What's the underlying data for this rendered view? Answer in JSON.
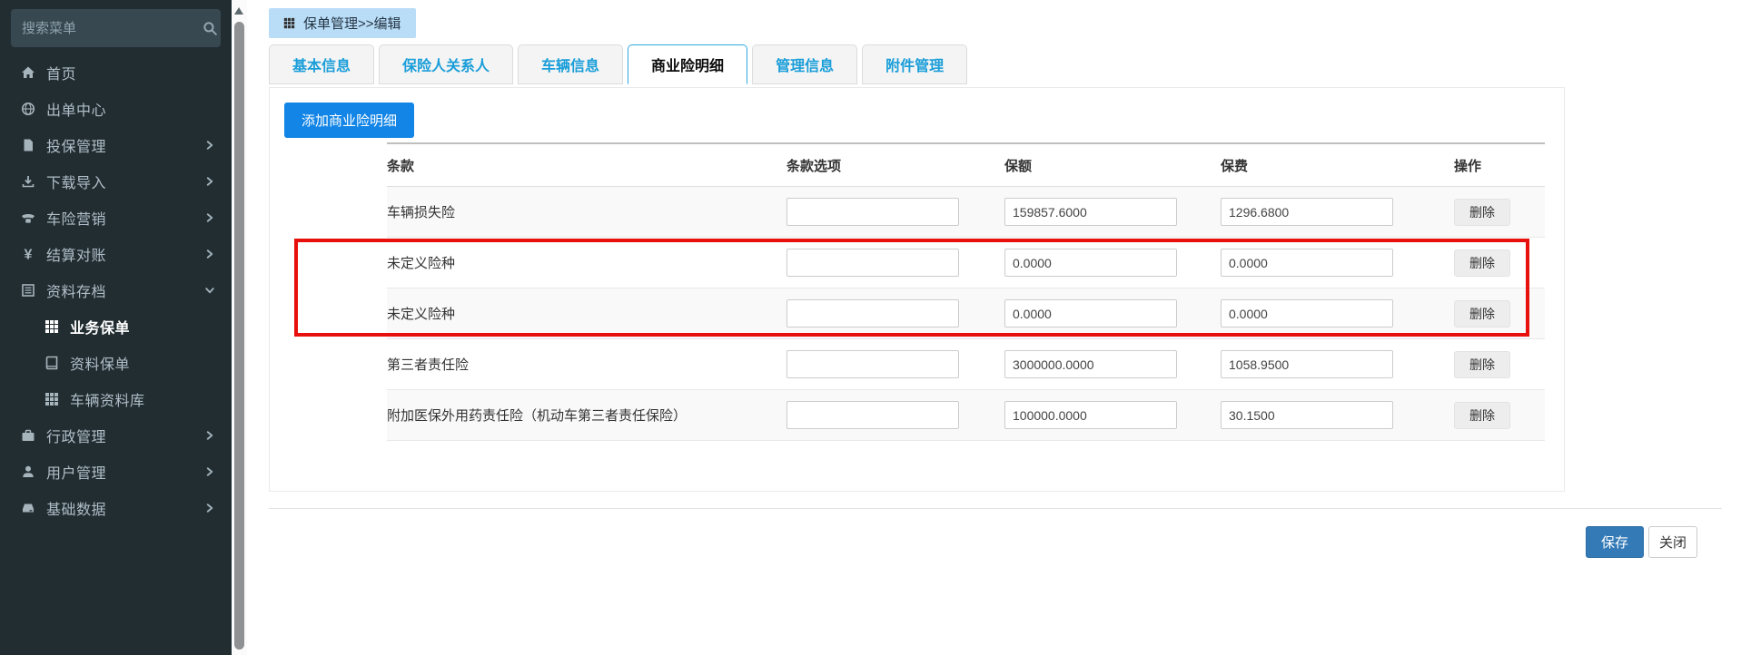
{
  "sidebar": {
    "search_placeholder": "搜索菜单",
    "items": [
      {
        "key": "home",
        "icon": "home",
        "label": "首页"
      },
      {
        "key": "issue-center",
        "icon": "globe",
        "label": "出单中心"
      },
      {
        "key": "insure-management",
        "icon": "file",
        "label": "投保管理",
        "chevron": "right"
      },
      {
        "key": "download-import",
        "icon": "download",
        "label": "下载导入",
        "chevron": "right"
      },
      {
        "key": "vehicle-marketing",
        "icon": "phone",
        "label": "车险营销",
        "chevron": "right"
      },
      {
        "key": "settlement",
        "icon": "yen",
        "label": "结算对账",
        "chevron": "right"
      },
      {
        "key": "archive",
        "icon": "archive",
        "label": "资料存档",
        "chevron": "down"
      },
      {
        "key": "business-policy",
        "icon": "grid",
        "label": "业务保单",
        "sub": true,
        "active": true
      },
      {
        "key": "data-policy",
        "icon": "book",
        "label": "资料保单",
        "sub": true
      },
      {
        "key": "vehicle-database",
        "icon": "grid",
        "label": "车辆资料库",
        "sub": true
      },
      {
        "key": "admin-management",
        "icon": "briefcase",
        "label": "行政管理",
        "chevron": "right"
      },
      {
        "key": "user-management",
        "icon": "user",
        "label": "用户管理",
        "chevron": "right"
      },
      {
        "key": "base-data",
        "icon": "hdd",
        "label": "基础数据",
        "chevron": "right"
      }
    ]
  },
  "breadcrumb": {
    "icon": "grid",
    "label": "保单管理>>编辑"
  },
  "tabs": [
    {
      "key": "basic-info",
      "label": "基本信息"
    },
    {
      "key": "insured-parties",
      "label": "保险人关系人"
    },
    {
      "key": "vehicle-info",
      "label": "车辆信息"
    },
    {
      "key": "commercial-detail",
      "label": "商业险明细",
      "active": true
    },
    {
      "key": "management-info",
      "label": "管理信息"
    },
    {
      "key": "attachment",
      "label": "附件管理"
    }
  ],
  "content": {
    "add_button_label": "添加商业险明细",
    "table": {
      "headers": [
        "条款",
        "条款选项",
        "保额",
        "保费",
        "操作"
      ],
      "rows": [
        {
          "clause": "车辆损失险",
          "option": "",
          "amount": "159857.6000",
          "premium": "1296.6800",
          "action": "删除",
          "highlighted": false
        },
        {
          "clause": "未定义险种",
          "option": "",
          "amount": "0.0000",
          "premium": "0.0000",
          "action": "删除",
          "highlighted": true
        },
        {
          "clause": "未定义险种",
          "option": "",
          "amount": "0.0000",
          "premium": "0.0000",
          "action": "删除",
          "highlighted": true
        },
        {
          "clause": "第三者责任险",
          "option": "",
          "amount": "3000000.0000",
          "premium": "1058.9500",
          "action": "删除",
          "highlighted": false
        },
        {
          "clause": "附加医保外用药责任险（机动车第三者责任保险）",
          "option": "",
          "amount": "100000.0000",
          "premium": "30.1500",
          "action": "删除",
          "highlighted": false
        }
      ]
    }
  },
  "footer": {
    "save_label": "保存",
    "close_label": "关闭"
  },
  "colors": {
    "sidebar_bg": "#222d32",
    "accent_blue": "#1285e6",
    "tab_text_blue": "#1a9ed9",
    "breadcrumb_bg": "#b9ddf7",
    "primary_button_blue": "#337ab7",
    "highlight_red": "#e8100c"
  }
}
